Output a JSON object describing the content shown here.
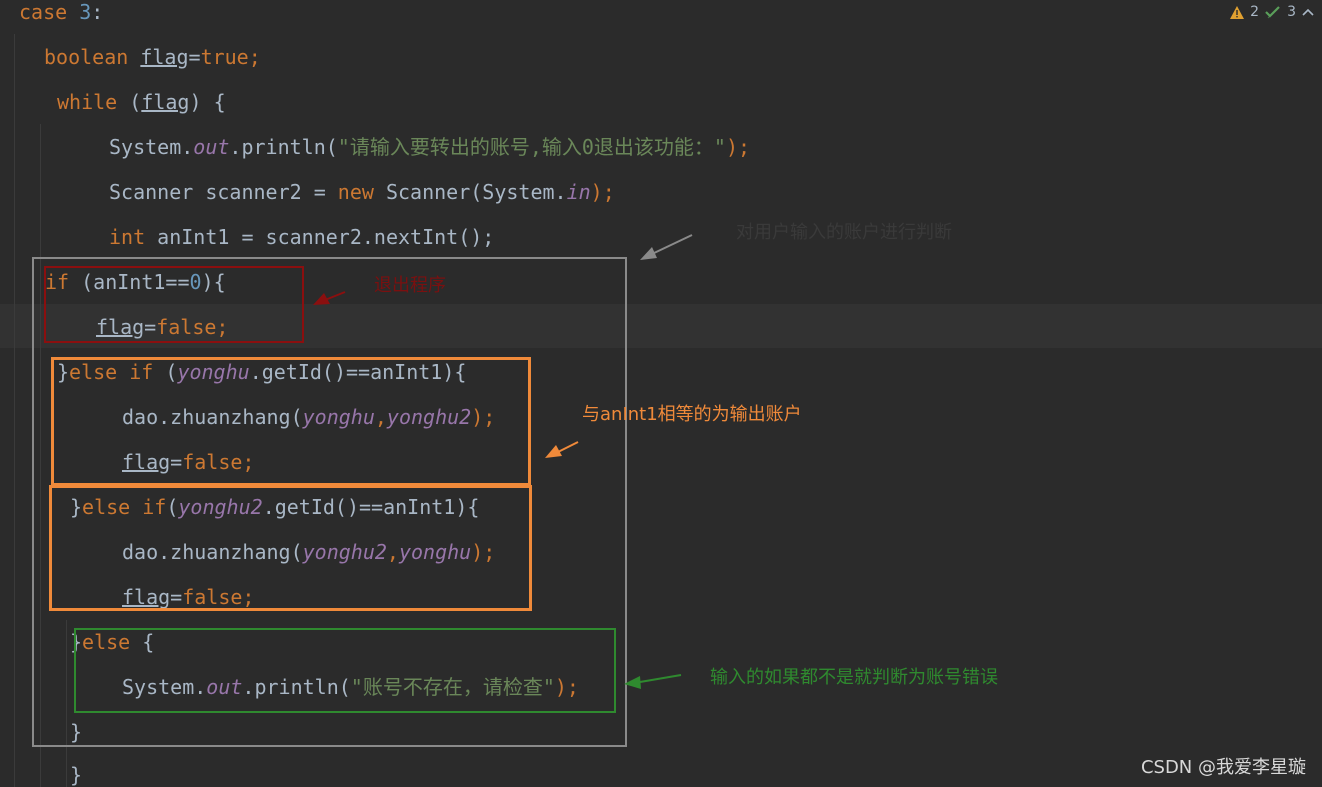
{
  "status": {
    "warnings": "2",
    "checks": "3"
  },
  "code": {
    "l1_case": "case",
    "l1_num": "3",
    "l1_colon": ":",
    "l2_type": "boolean",
    "l2_var": "flag",
    "l2_eq": "=",
    "l2_val": "true",
    "l2_semi": ";",
    "l3_kw": "while",
    "l3_open": "(",
    "l3_var": "flag",
    "l3_close": ") {",
    "l4_a": "System.",
    "l4_out": "out",
    "l4_b": ".println(",
    "l4_str": "\"请输入要转出的账号,输入0退出该功能：\"",
    "l4_c": ");",
    "l5_a": "Scanner scanner2 = ",
    "l5_new": "new",
    "l5_b": " Scanner(System.",
    "l5_in": "in",
    "l5_c": ");",
    "l6_type": "int",
    "l6_b": " anInt1 = scanner2.nextInt();",
    "l7_if": "if",
    "l7_a": " (anInt1==",
    "l7_num": "0",
    "l7_b": "){",
    "l8_var": "flag",
    "l8_eq": "=",
    "l8_val": "false;",
    "l9_a": "}",
    "l9_kw": "else if",
    "l9_b": " (",
    "l9_fld": "yonghu",
    "l9_c": ".getId()==anInt1){",
    "l10_a": "dao.zhuanzhang(",
    "l10_f1": "yonghu",
    "l10_comma": ",",
    "l10_f2": "yonghu2",
    "l10_b": ");",
    "l11_var": "flag",
    "l11_eq": "=",
    "l11_val": "false;",
    "l12_a": "}",
    "l12_kw": "else if",
    "l12_b": "(",
    "l12_fld": "yonghu2",
    "l12_c": ".getId()==anInt1){",
    "l13_a": "dao.zhuanzhang(",
    "l13_f1": "yonghu2",
    "l13_comma": ",",
    "l13_f2": "yonghu",
    "l13_b": ");",
    "l14_var": "flag",
    "l14_eq": "=",
    "l14_val": "false;",
    "l15_a": "}",
    "l15_kw": "else",
    "l15_b": " {",
    "l16_a": "System.",
    "l16_out": "out",
    "l16_b": ".println(",
    "l16_str": "\"账号不存在，请检查\"",
    "l16_c": ");",
    "l17": "}",
    "l18": "}"
  },
  "annotations": {
    "judge": "对用户输入的账户进行判断",
    "exit": "退出程序",
    "equal": "与anInt1相等的为输出账户",
    "error": "输入的如果都不是就判断为账号错误"
  },
  "colors": {
    "gray": "#8a8a8a",
    "red": "#8b0f0f",
    "orange": "#f08a3a",
    "green": "#2f8a2f"
  },
  "watermark": "CSDN @我爱李星璇"
}
